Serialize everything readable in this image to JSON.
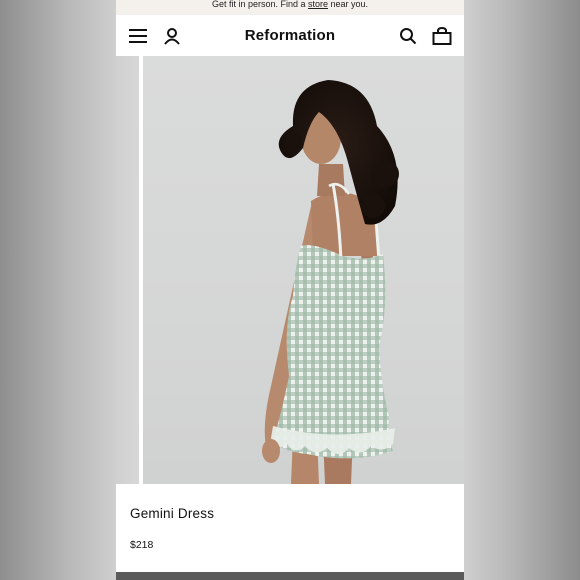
{
  "promo": {
    "text_before": "Get fit in person. Find a",
    "link_text": "store",
    "text_after": "near you."
  },
  "header": {
    "brand": "Reformation",
    "icons": [
      "menu-icon",
      "account-icon",
      "search-icon",
      "bag-icon"
    ]
  },
  "product": {
    "name": "Gemini Dress",
    "price": "$218",
    "image_alt": "Model wearing a green gingham smocked mini dress"
  },
  "colors": {
    "background": "#ffffff",
    "text": "#111111",
    "dress_green": "#8fae98"
  }
}
